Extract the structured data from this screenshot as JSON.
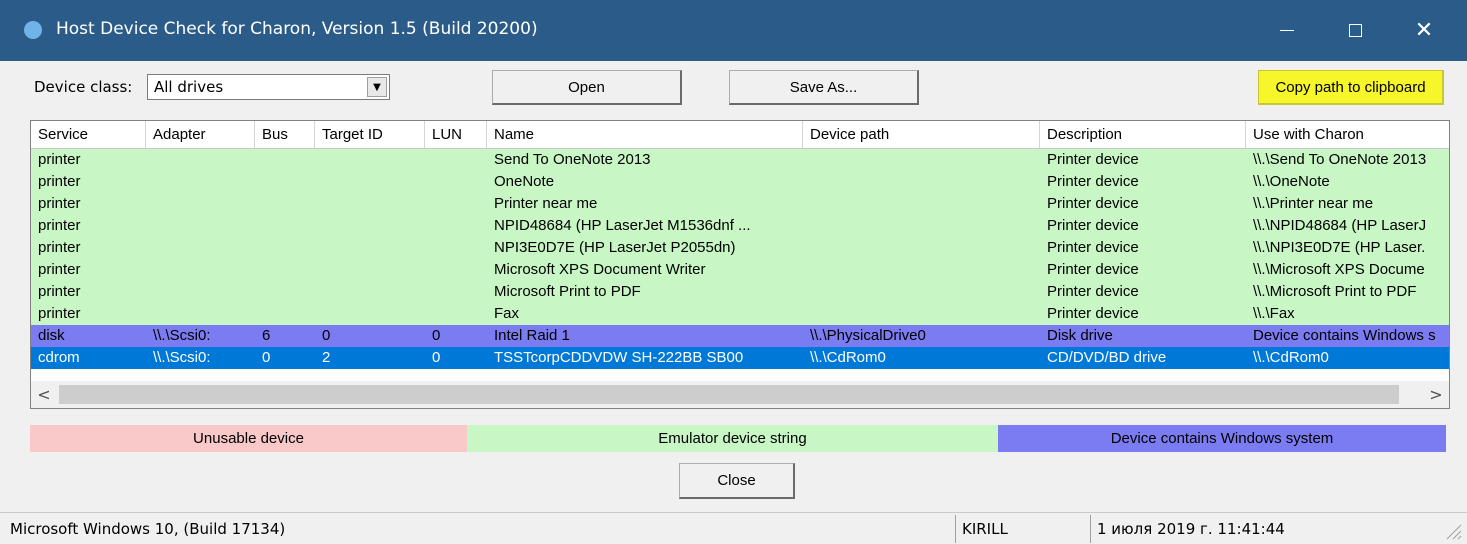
{
  "window": {
    "title": "Host Device Check for Charon, Version 1.5 (Build 20200)",
    "icon": "app-icon"
  },
  "toolbar": {
    "device_class_label": "Device class:",
    "device_class_value": "All drives",
    "open_label": "Open",
    "save_as_label": "Save As...",
    "copy_label": "Copy path to clipboard"
  },
  "table": {
    "columns": [
      "Service",
      "Adapter",
      "Bus",
      "Target ID",
      "LUN",
      "Name",
      "Device path",
      "Description",
      "Use with Charon"
    ],
    "rows": [
      {
        "style": "green",
        "cells": [
          "printer",
          "",
          "",
          "",
          "",
          "Send To OneNote 2013",
          "",
          "Printer device",
          "\\\\.\\Send To OneNote 2013"
        ]
      },
      {
        "style": "green",
        "cells": [
          "printer",
          "",
          "",
          "",
          "",
          "OneNote",
          "",
          "Printer device",
          "\\\\.\\OneNote"
        ]
      },
      {
        "style": "green",
        "cells": [
          "printer",
          "",
          "",
          "",
          "",
          "Printer near me",
          "",
          "Printer device",
          "\\\\.\\Printer near me"
        ]
      },
      {
        "style": "green",
        "cells": [
          "printer",
          "",
          "",
          "",
          "",
          "NPID48684 (HP LaserJet M1536dnf ...",
          "",
          "Printer device",
          "\\\\.\\NPID48684 (HP LaserJ"
        ]
      },
      {
        "style": "green",
        "cells": [
          "printer",
          "",
          "",
          "",
          "",
          "NPI3E0D7E (HP LaserJet P2055dn)",
          "",
          "Printer device",
          "\\\\.\\NPI3E0D7E (HP Laser."
        ]
      },
      {
        "style": "green",
        "cells": [
          "printer",
          "",
          "",
          "",
          "",
          "Microsoft XPS Document Writer",
          "",
          "Printer device",
          "\\\\.\\Microsoft XPS Docume"
        ]
      },
      {
        "style": "green",
        "cells": [
          "printer",
          "",
          "",
          "",
          "",
          "Microsoft Print to PDF",
          "",
          "Printer device",
          "\\\\.\\Microsoft Print to PDF"
        ]
      },
      {
        "style": "green",
        "cells": [
          "printer",
          "",
          "",
          "",
          "",
          "Fax",
          "",
          "Printer device",
          "\\\\.\\Fax"
        ]
      },
      {
        "style": "purple",
        "cells": [
          "disk",
          "\\\\.\\Scsi0:",
          "6",
          "0",
          "0",
          "Intel Raid 1",
          "\\\\.\\PhysicalDrive0",
          "Disk drive",
          "Device contains Windows s"
        ]
      },
      {
        "style": "selected",
        "cells": [
          "cdrom",
          "\\\\.\\Scsi0:",
          "0",
          "2",
          "0",
          "TSSTcorpCDDVDW SH-222BB SB00",
          "\\\\.\\CdRom0",
          "CD/DVD/BD drive",
          "\\\\.\\CdRom0"
        ]
      }
    ]
  },
  "legend": {
    "unusable": "Unusable device",
    "emulator": "Emulator device string",
    "windows": "Device contains Windows system"
  },
  "close_label": "Close",
  "status": {
    "os": "Microsoft Windows 10,  (Build 17134)",
    "user": "KIRILL",
    "datetime": "1 июля 2019 г. 11:41:44"
  },
  "colors": {
    "titlebar": "#2b5c89",
    "emulator": "#c8f7c5",
    "windows": "#7c7cf2",
    "unusable": "#f9c8c8",
    "selected": "#0078d7",
    "copy_button": "#f6f62a"
  }
}
